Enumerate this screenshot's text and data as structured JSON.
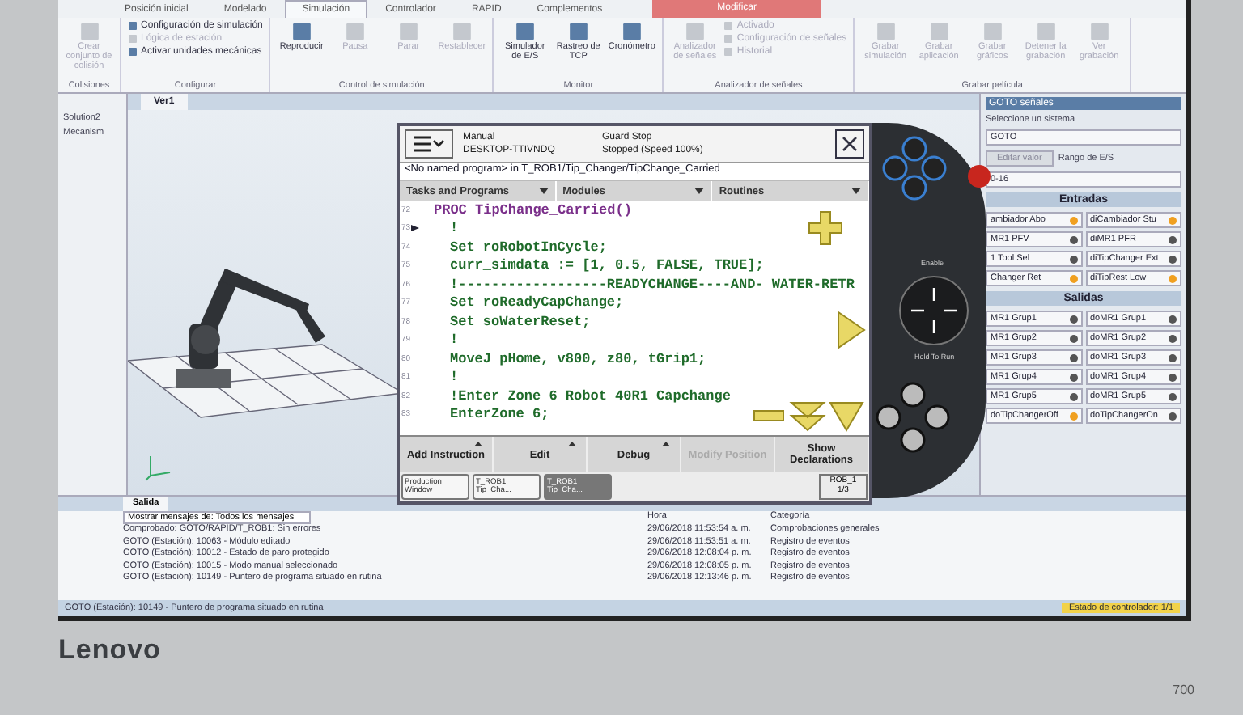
{
  "ribbon_tabs": [
    {
      "label": "Posición inicial",
      "selected": false
    },
    {
      "label": "Modelado",
      "selected": false
    },
    {
      "label": "Simulación",
      "selected": true
    },
    {
      "label": "Controlador",
      "selected": false
    },
    {
      "label": "RAPID",
      "selected": false
    },
    {
      "label": "Complementos",
      "selected": false
    }
  ],
  "context_tab": {
    "label": "Modificar"
  },
  "ribbon_groups": [
    {
      "label": "Colisiones",
      "items": [
        {
          "kind": "large",
          "label": "Crear conjunto de colisión",
          "disabled": true
        }
      ]
    },
    {
      "label": "Configurar",
      "items": [
        {
          "kind": "small",
          "label": "Configuración de simulación",
          "disabled": false
        },
        {
          "kind": "small",
          "label": "Lógica de estación",
          "disabled": true
        },
        {
          "kind": "small",
          "label": "Activar unidades mecánicas",
          "disabled": false
        }
      ]
    },
    {
      "label": "Control de simulación",
      "items": [
        {
          "kind": "large",
          "label": "Reproducir",
          "disabled": false
        },
        {
          "kind": "large",
          "label": "Pausa",
          "disabled": true
        },
        {
          "kind": "large",
          "label": "Parar",
          "disabled": true
        },
        {
          "kind": "large",
          "label": "Restablecer",
          "disabled": true
        }
      ]
    },
    {
      "label": "Monitor",
      "items": [
        {
          "kind": "large",
          "label": "Simulador de E/S",
          "disabled": false
        },
        {
          "kind": "large",
          "label": "Rastreo de TCP",
          "disabled": false
        },
        {
          "kind": "large",
          "label": "Cronómetro",
          "disabled": false
        }
      ]
    },
    {
      "label": "Analizador de señales",
      "items": [
        {
          "kind": "large",
          "label": "Analizador de señales",
          "disabled": true
        },
        {
          "kind": "small",
          "label": "Activado",
          "disabled": true
        },
        {
          "kind": "small",
          "label": "Configuración de señales",
          "disabled": true
        },
        {
          "kind": "small",
          "label": "Historial",
          "disabled": true
        }
      ]
    },
    {
      "label": "Grabar película",
      "items": [
        {
          "kind": "large",
          "label": "Grabar simulación",
          "disabled": true
        },
        {
          "kind": "large",
          "label": "Grabar aplicación",
          "disabled": true
        },
        {
          "kind": "large",
          "label": "Grabar gráficos",
          "disabled": true
        },
        {
          "kind": "large",
          "label": "Detener la grabación",
          "disabled": true
        },
        {
          "kind": "large",
          "label": "Ver grabación",
          "disabled": true
        }
      ]
    }
  ],
  "layout_tree": [
    {
      "label": "Solution2"
    },
    {
      "label": "Mecanism"
    }
  ],
  "view_tab": {
    "label": "Ver1"
  },
  "pendant": {
    "mode": "Manual",
    "system": "DESKTOP-TTIVNDQ",
    "state": "Guard Stop",
    "speed": "Stopped (Speed 100%)",
    "path": "<No named program> in T_ROB1/Tip_Changer/TipChange_Carried",
    "tabs": [
      "Tasks and Programs",
      "Modules",
      "Routines"
    ],
    "code": [
      {
        "number": "72",
        "kind": "header",
        "text": "PROC TipChange_Carried()",
        "pointer": false
      },
      {
        "number": "73",
        "kind": "statement",
        "text": "!",
        "pointer": true
      },
      {
        "number": "74",
        "kind": "statement",
        "text": "Set roRobotInCycle;",
        "pointer": false
      },
      {
        "number": "75",
        "kind": "statement",
        "text": "curr_simdata := [1, 0.5, FALSE, TRUE];",
        "pointer": false
      },
      {
        "number": "76",
        "kind": "statement",
        "text": "!------------------READYCHANGE----AND- WATER-RETR",
        "pointer": false
      },
      {
        "number": "77",
        "kind": "statement",
        "text": "Set roReadyCapChange;",
        "pointer": false
      },
      {
        "number": "78",
        "kind": "statement",
        "text": "Set soWaterReset;",
        "pointer": false
      },
      {
        "number": "79",
        "kind": "statement",
        "text": "!",
        "pointer": false
      },
      {
        "number": "80",
        "kind": "statement",
        "text": "MoveJ pHome, v800, z80, tGrip1;",
        "pointer": false
      },
      {
        "number": "81",
        "kind": "statement",
        "text": "!",
        "pointer": false
      },
      {
        "number": "82",
        "kind": "statement",
        "text": "!Enter Zone 6 Robot 40R1 Capchange",
        "pointer": false
      },
      {
        "number": "83",
        "kind": "statement",
        "text": "EnterZone 6;",
        "pointer": false
      }
    ],
    "buttons": [
      {
        "label": "Add Instruction",
        "disabled": false,
        "menu": true
      },
      {
        "label": "Edit",
        "disabled": false,
        "menu": true
      },
      {
        "label": "Debug",
        "disabled": false,
        "menu": true
      },
      {
        "label": "Modify Position",
        "disabled": true,
        "menu": false
      },
      {
        "label": "Show Declarations",
        "disabled": false,
        "menu": false
      }
    ],
    "taskbar": [
      {
        "label": "Production Window",
        "selected": false
      },
      {
        "label": "T_ROB1 Tip_Cha...",
        "selected": false
      },
      {
        "label": "T_ROB1 Tip_Cha...",
        "selected": true
      }
    ],
    "robot": "ROB_1",
    "fraction": "1/3",
    "enable_label": "Enable",
    "hold_label": "Hold To Run"
  },
  "signals_panel": {
    "title": "GOTO señales",
    "prompt": "Seleccione un sistema",
    "system": "GOTO",
    "edit_button": "Editar valor",
    "range_label": "Rango de E/S",
    "range": "0-16",
    "sections": [
      {
        "title": "Entradas",
        "signals": [
          {
            "label": "ambiador Abo",
            "on": true
          },
          {
            "label": "diCambiador Stu",
            "on": true
          },
          {
            "label": "MR1 PFV",
            "on": false
          },
          {
            "label": "diMR1 PFR",
            "on": false
          },
          {
            "label": "1 Tool Sel",
            "on": false
          },
          {
            "label": "diTipChanger Ext",
            "on": false
          },
          {
            "label": "Changer Ret",
            "on": true
          },
          {
            "label": "diTipRest Low",
            "on": true
          }
        ]
      },
      {
        "title": "Salidas",
        "signals": [
          {
            "label": "MR1 Grup1",
            "on": false
          },
          {
            "label": "doMR1 Grup1",
            "on": false
          },
          {
            "label": "MR1 Grup2",
            "on": false
          },
          {
            "label": "doMR1 Grup2",
            "on": false
          },
          {
            "label": "MR1 Grup3",
            "on": false
          },
          {
            "label": "doMR1 Grup3",
            "on": false
          },
          {
            "label": "MR1 Grup4",
            "on": false
          },
          {
            "label": "doMR1 Grup4",
            "on": false
          },
          {
            "label": "MR1 Grup5",
            "on": false
          },
          {
            "label": "doMR1 Grup5",
            "on": false
          },
          {
            "label": "doTipChangerOff",
            "on": true
          },
          {
            "label": "doTipChangerOn",
            "on": false
          }
        ]
      }
    ]
  },
  "output": {
    "tab": "Salida",
    "filter": "Mostrar mensajes de: Todos los mensajes",
    "columns": [
      "Hora",
      "Categoría"
    ],
    "messages": [
      {
        "text": "Comprobado: GOTO/RAPID/T_ROB1: Sin errores",
        "time": "29/06/2018 11:53:54 a. m.",
        "category": "Comprobaciones generales"
      },
      {
        "text": "GOTO (Estación): 10063 - Módulo editado",
        "time": "29/06/2018 11:53:51 a. m.",
        "category": "Registro de eventos"
      },
      {
        "text": "GOTO (Estación): 10012 - Estado de paro protegido",
        "time": "29/06/2018 12:08:04 p. m.",
        "category": "Registro de eventos"
      },
      {
        "text": "GOTO (Estación): 10015 - Modo manual seleccionado",
        "time": "29/06/2018 12:08:05 p. m.",
        "category": "Registro de eventos"
      },
      {
        "text": "GOTO (Estación): 10149 - Puntero de programa situado en rutina",
        "time": "29/06/2018 12:13:46 p. m.",
        "category": "Registro de eventos"
      }
    ]
  },
  "status_bar": {
    "text": "GOTO (Estación): 10149 - Puntero de programa situado en rutina",
    "controller": "Estado de controlador: 1/1"
  },
  "bezel": {
    "brand": "Lenovo",
    "model": "700"
  }
}
